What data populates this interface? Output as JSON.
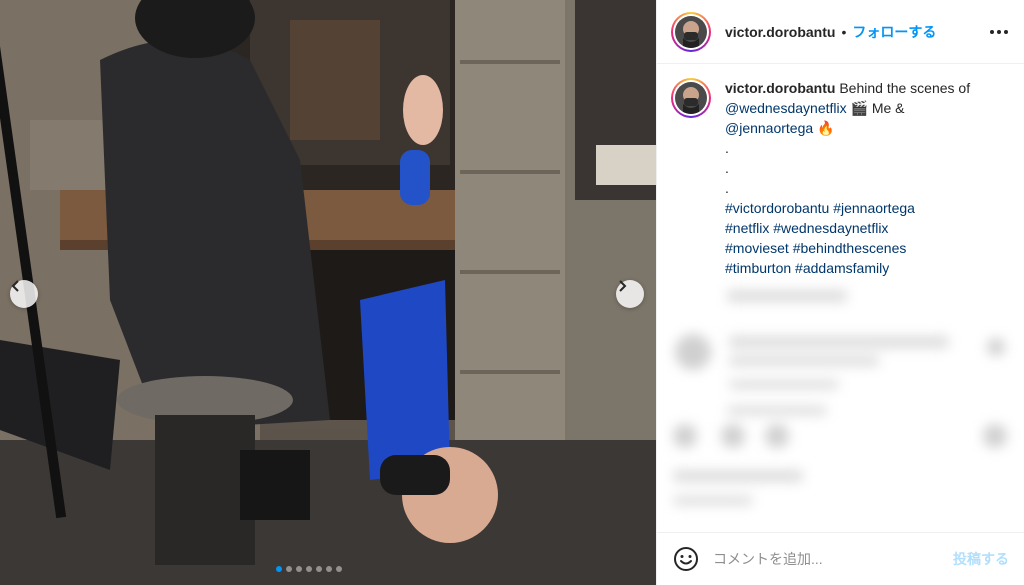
{
  "colors": {
    "accent": "#0095f6",
    "link": "#00376b",
    "post_disabled": "#b2dffc"
  },
  "photo": {
    "description_icon": "photo",
    "carousel": {
      "total": 7,
      "active_index": 0
    },
    "nav": {
      "prev_icon": "chevron-left-icon",
      "next_icon": "chevron-right-icon"
    }
  },
  "header": {
    "username": "victor.dorobantu",
    "separator": "•",
    "follow_label": "フォローする",
    "more_icon": "more-horizontal-icon"
  },
  "caption": {
    "username": "victor.dorobantu",
    "text_1": "Behind the scenes of ",
    "mention_1": "@wednesdaynetflix",
    "emoji_1": "🎬",
    "text_2": " Me & ",
    "mention_2": "@jennaortega",
    "emoji_2": "🔥",
    "dot_lines": [
      ".",
      ".",
      "."
    ],
    "hashtags": [
      "#victordorobantu",
      "#jennaortega",
      "#netflix",
      "#wednesdaynetflix",
      "#movieset",
      "#behindthescenes",
      "#timburton",
      "#addamsfamily"
    ]
  },
  "comment_box": {
    "emoji_icon": "smiley-icon",
    "placeholder": "コメントを追加...",
    "post_label": "投稿する"
  }
}
